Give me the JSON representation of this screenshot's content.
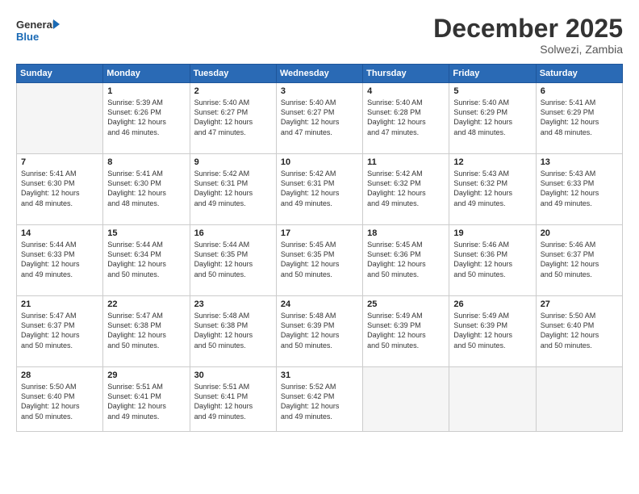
{
  "logo": {
    "line1": "General",
    "line2": "Blue"
  },
  "title": "December 2025",
  "subtitle": "Solwezi, Zambia",
  "weekdays": [
    "Sunday",
    "Monday",
    "Tuesday",
    "Wednesday",
    "Thursday",
    "Friday",
    "Saturday"
  ],
  "weeks": [
    [
      {
        "day": "",
        "info": ""
      },
      {
        "day": "1",
        "info": "Sunrise: 5:39 AM\nSunset: 6:26 PM\nDaylight: 12 hours\nand 46 minutes."
      },
      {
        "day": "2",
        "info": "Sunrise: 5:40 AM\nSunset: 6:27 PM\nDaylight: 12 hours\nand 47 minutes."
      },
      {
        "day": "3",
        "info": "Sunrise: 5:40 AM\nSunset: 6:27 PM\nDaylight: 12 hours\nand 47 minutes."
      },
      {
        "day": "4",
        "info": "Sunrise: 5:40 AM\nSunset: 6:28 PM\nDaylight: 12 hours\nand 47 minutes."
      },
      {
        "day": "5",
        "info": "Sunrise: 5:40 AM\nSunset: 6:29 PM\nDaylight: 12 hours\nand 48 minutes."
      },
      {
        "day": "6",
        "info": "Sunrise: 5:41 AM\nSunset: 6:29 PM\nDaylight: 12 hours\nand 48 minutes."
      }
    ],
    [
      {
        "day": "7",
        "info": "Sunrise: 5:41 AM\nSunset: 6:30 PM\nDaylight: 12 hours\nand 48 minutes."
      },
      {
        "day": "8",
        "info": "Sunrise: 5:41 AM\nSunset: 6:30 PM\nDaylight: 12 hours\nand 48 minutes."
      },
      {
        "day": "9",
        "info": "Sunrise: 5:42 AM\nSunset: 6:31 PM\nDaylight: 12 hours\nand 49 minutes."
      },
      {
        "day": "10",
        "info": "Sunrise: 5:42 AM\nSunset: 6:31 PM\nDaylight: 12 hours\nand 49 minutes."
      },
      {
        "day": "11",
        "info": "Sunrise: 5:42 AM\nSunset: 6:32 PM\nDaylight: 12 hours\nand 49 minutes."
      },
      {
        "day": "12",
        "info": "Sunrise: 5:43 AM\nSunset: 6:32 PM\nDaylight: 12 hours\nand 49 minutes."
      },
      {
        "day": "13",
        "info": "Sunrise: 5:43 AM\nSunset: 6:33 PM\nDaylight: 12 hours\nand 49 minutes."
      }
    ],
    [
      {
        "day": "14",
        "info": "Sunrise: 5:44 AM\nSunset: 6:33 PM\nDaylight: 12 hours\nand 49 minutes."
      },
      {
        "day": "15",
        "info": "Sunrise: 5:44 AM\nSunset: 6:34 PM\nDaylight: 12 hours\nand 50 minutes."
      },
      {
        "day": "16",
        "info": "Sunrise: 5:44 AM\nSunset: 6:35 PM\nDaylight: 12 hours\nand 50 minutes."
      },
      {
        "day": "17",
        "info": "Sunrise: 5:45 AM\nSunset: 6:35 PM\nDaylight: 12 hours\nand 50 minutes."
      },
      {
        "day": "18",
        "info": "Sunrise: 5:45 AM\nSunset: 6:36 PM\nDaylight: 12 hours\nand 50 minutes."
      },
      {
        "day": "19",
        "info": "Sunrise: 5:46 AM\nSunset: 6:36 PM\nDaylight: 12 hours\nand 50 minutes."
      },
      {
        "day": "20",
        "info": "Sunrise: 5:46 AM\nSunset: 6:37 PM\nDaylight: 12 hours\nand 50 minutes."
      }
    ],
    [
      {
        "day": "21",
        "info": "Sunrise: 5:47 AM\nSunset: 6:37 PM\nDaylight: 12 hours\nand 50 minutes."
      },
      {
        "day": "22",
        "info": "Sunrise: 5:47 AM\nSunset: 6:38 PM\nDaylight: 12 hours\nand 50 minutes."
      },
      {
        "day": "23",
        "info": "Sunrise: 5:48 AM\nSunset: 6:38 PM\nDaylight: 12 hours\nand 50 minutes."
      },
      {
        "day": "24",
        "info": "Sunrise: 5:48 AM\nSunset: 6:39 PM\nDaylight: 12 hours\nand 50 minutes."
      },
      {
        "day": "25",
        "info": "Sunrise: 5:49 AM\nSunset: 6:39 PM\nDaylight: 12 hours\nand 50 minutes."
      },
      {
        "day": "26",
        "info": "Sunrise: 5:49 AM\nSunset: 6:39 PM\nDaylight: 12 hours\nand 50 minutes."
      },
      {
        "day": "27",
        "info": "Sunrise: 5:50 AM\nSunset: 6:40 PM\nDaylight: 12 hours\nand 50 minutes."
      }
    ],
    [
      {
        "day": "28",
        "info": "Sunrise: 5:50 AM\nSunset: 6:40 PM\nDaylight: 12 hours\nand 50 minutes."
      },
      {
        "day": "29",
        "info": "Sunrise: 5:51 AM\nSunset: 6:41 PM\nDaylight: 12 hours\nand 49 minutes."
      },
      {
        "day": "30",
        "info": "Sunrise: 5:51 AM\nSunset: 6:41 PM\nDaylight: 12 hours\nand 49 minutes."
      },
      {
        "day": "31",
        "info": "Sunrise: 5:52 AM\nSunset: 6:42 PM\nDaylight: 12 hours\nand 49 minutes."
      },
      {
        "day": "",
        "info": ""
      },
      {
        "day": "",
        "info": ""
      },
      {
        "day": "",
        "info": ""
      }
    ]
  ]
}
